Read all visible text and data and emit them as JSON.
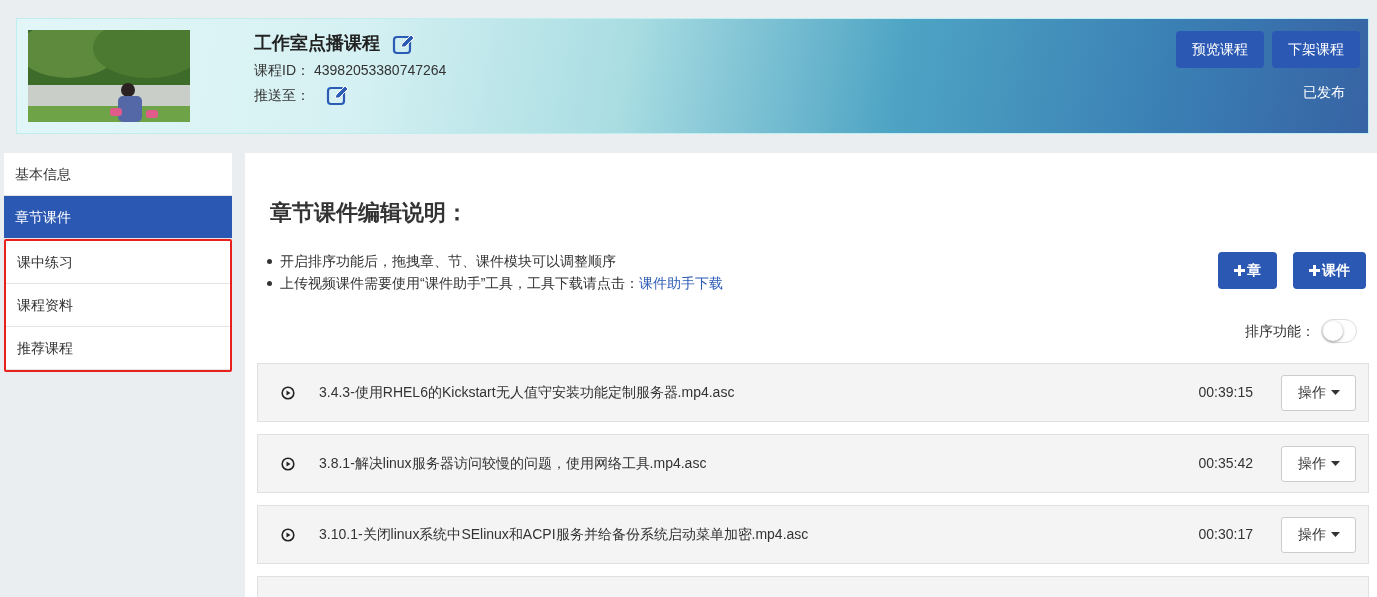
{
  "course": {
    "kind": "picture",
    "title": "工作室点播课程",
    "id_label": "课程ID：",
    "id_value": "43982053380747264",
    "push_label": "推送至：",
    "buttons": [
      "预览课程",
      "下架课程"
    ],
    "status": "已发布"
  },
  "sidebar": {
    "items": [
      {
        "label": "基本信息",
        "selected": false,
        "highlighted": false
      },
      {
        "label": "章节课件",
        "selected": true,
        "highlighted": false
      },
      {
        "label": "课中练习",
        "selected": false,
        "highlighted": true
      },
      {
        "label": "课程资料",
        "selected": false,
        "highlighted": true
      },
      {
        "label": "推荐课程",
        "selected": false,
        "highlighted": true
      }
    ]
  },
  "main": {
    "heading": "章节课件编辑说明：",
    "notes": [
      {
        "text": "开启排序功能后，拖拽章、节、课件模块可以调整顺序"
      },
      {
        "text": "上传视频课件需要使用“课件助手”工具，工具下载请点击：",
        "link": "课件助手下载"
      }
    ],
    "add_buttons": [
      "章",
      "课件"
    ],
    "sort": {
      "label": "排序功能：",
      "on": false
    },
    "lessons": [
      {
        "title": "3.4.3-使用RHEL6的Kickstart无人值守安装功能定制服务器.mp4.asc",
        "duration": "00:39:15",
        "action": "操作"
      },
      {
        "title": "3.8.1-解决linux服务器访问较慢的问题，使用网络工具.mp4.asc",
        "duration": "00:35:42",
        "action": "操作"
      },
      {
        "title": "3.10.1-关闭linux系统中SElinux和ACPI服务并给备份系统启动菜单加密.mp4.asc",
        "duration": "00:30:17",
        "action": "操作"
      }
    ]
  }
}
